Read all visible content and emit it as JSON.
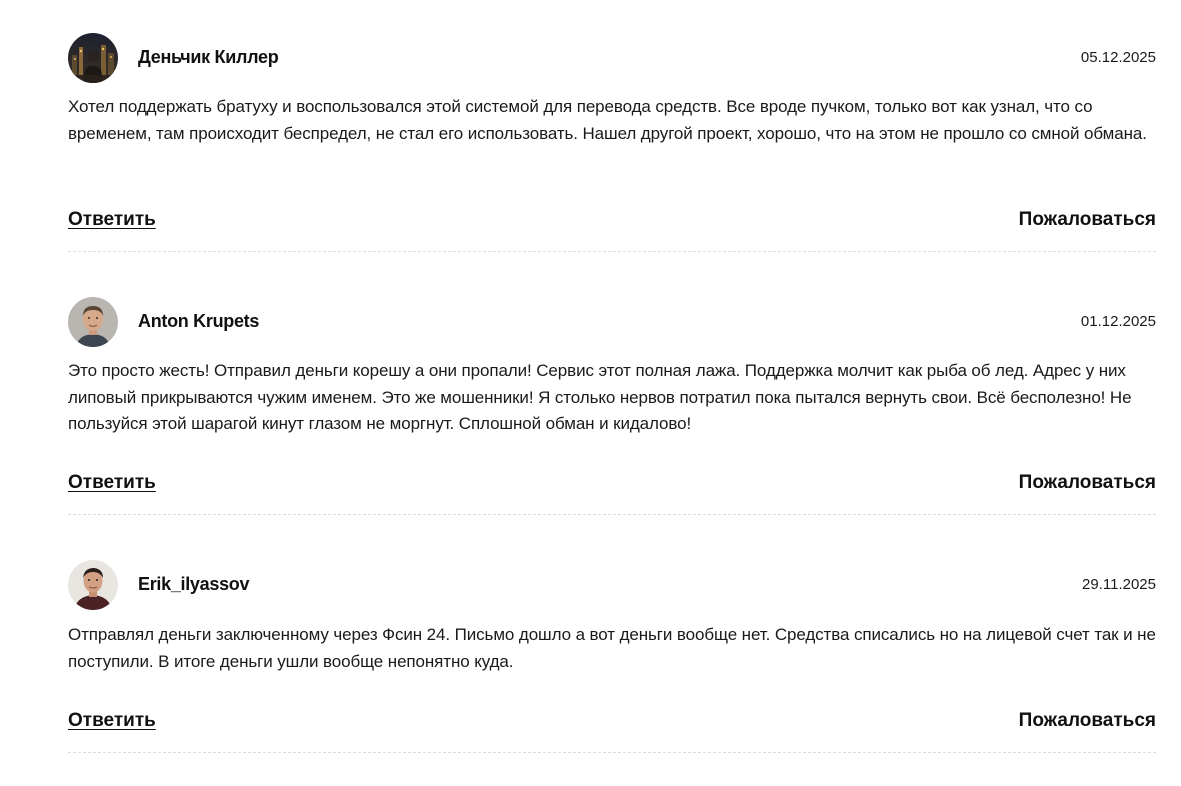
{
  "reviews": [
    {
      "author": "Деньчик Киллер",
      "date": "05.12.2025",
      "text": "Хотел поддержать братуху и воспользовался этой системой для перевода средств. Все вроде пучком, только вот как узнал, что со временем, там происходит беспредел, не стал его использовать. Нашел другой проект, хорошо, что на этом не прошло со смной обмана.",
      "reply_label": "Ответить",
      "report_label": "Пожаловаться",
      "avatar_icon": "avatar-night-city-photo"
    },
    {
      "author": "Anton Krupets",
      "date": "01.12.2025",
      "text": "Это просто жесть! Отправил деньги корешу а они пропали! Сервис этот полная лажа. Поддержка молчит как рыба об лед. Адрес у них липовый прикрываются чужим именем. Это же мошенники! Я столько нервов потратил пока пытался вернуть свои. Всё бесполезно! Не пользуйся этой шарагой кинут глазом не моргнут. Сплошной обман и кидалово!",
      "reply_label": "Ответить",
      "report_label": "Пожаловаться",
      "avatar_icon": "avatar-man-portrait"
    },
    {
      "author": "Erik_ilyassov",
      "date": "29.11.2025",
      "text": "Отправлял деньги заключенному через Фсин 24. Письмо дошло а вот деньги вообще нет. Средства списались но на лицевой счет так и не поступили. В итоге деньги ушли вообще непонятно куда.",
      "reply_label": "Ответить",
      "report_label": "Пожаловаться",
      "avatar_icon": "avatar-man-portrait"
    }
  ],
  "colors": {
    "text": "#1a1a1a",
    "divider": "#dcdcdc",
    "background": "#ffffff"
  }
}
